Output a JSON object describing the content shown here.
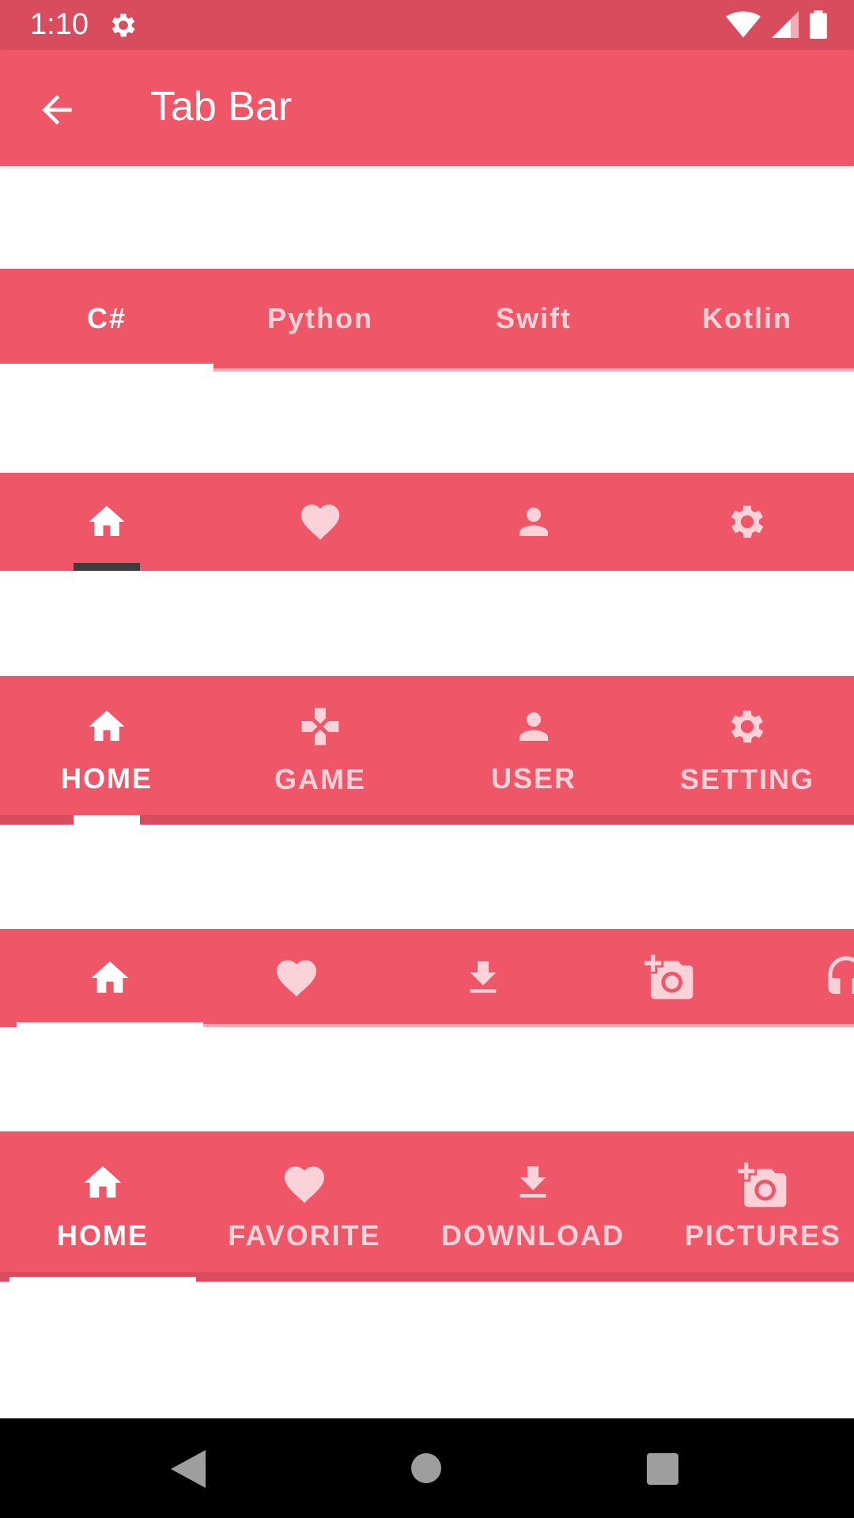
{
  "status_bar": {
    "time": "1:10",
    "icons": [
      "settings-icon",
      "wifi-icon",
      "signal-icon",
      "battery-icon"
    ]
  },
  "app_bar": {
    "title": "Tab Bar",
    "back_icon": "arrow-back-icon"
  },
  "tab_bar_1": {
    "tabs": [
      "C#",
      "Python",
      "Swift",
      "Kotlin"
    ],
    "selected": 0
  },
  "tab_bar_2": {
    "tabs": [
      "home-icon",
      "heart-icon",
      "person-icon",
      "settings-icon"
    ],
    "selected": 0
  },
  "tab_bar_3": {
    "tabs": [
      {
        "icon": "home-icon",
        "label": "HOME"
      },
      {
        "icon": "gamepad-icon",
        "label": "GAME"
      },
      {
        "icon": "person-icon",
        "label": "USER"
      },
      {
        "icon": "settings-icon",
        "label": "SETTING"
      }
    ],
    "selected": 0
  },
  "tab_bar_4": {
    "tabs": [
      "home-icon",
      "heart-icon",
      "download-icon",
      "add-a-photo-icon",
      "headset-icon"
    ],
    "selected": 0
  },
  "tab_bar_5": {
    "tabs": [
      {
        "icon": "home-icon",
        "label": "HOME"
      },
      {
        "icon": "heart-icon",
        "label": "FAVORITE"
      },
      {
        "icon": "download-icon",
        "label": "DOWNLOAD"
      },
      {
        "icon": "add-a-photo-icon",
        "label": "PICTURES"
      }
    ],
    "selected": 0
  },
  "colors": {
    "primary": "#ef5668",
    "status_bar": "#d94c5e",
    "unselected": "#fbd2d8",
    "selected": "#ffffff"
  },
  "nav_bar": {
    "buttons": [
      "back-triangle-icon",
      "home-circle-icon",
      "recents-square-icon"
    ]
  }
}
